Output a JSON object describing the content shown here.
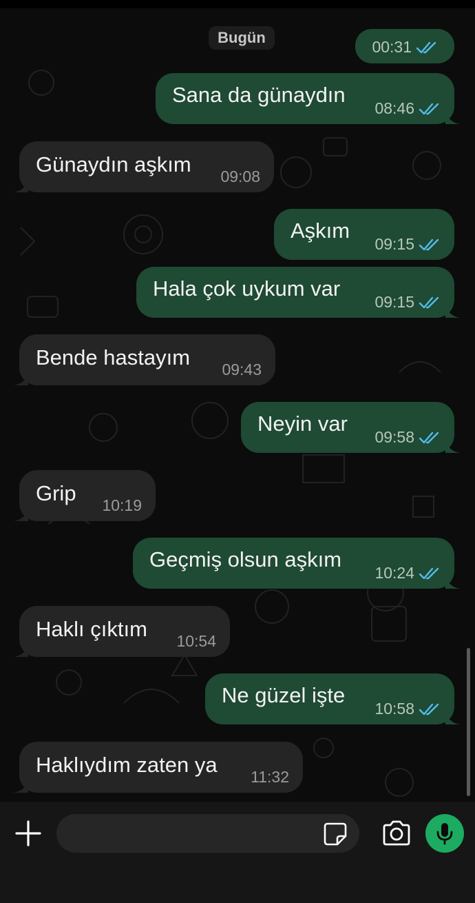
{
  "colors": {
    "outgoing_bubble": "#1f4a34",
    "incoming_bubble": "#252525",
    "read_ticks": "#53bdeb",
    "mic_button": "#1daa61",
    "background": "#0c0c0c"
  },
  "chat": {
    "date_separator": "Bugün",
    "messages": [
      {
        "direction": "out",
        "text": "",
        "time": "00:31",
        "status": "read"
      },
      {
        "direction": "out",
        "text": "Sana da günaydın",
        "time": "08:46",
        "status": "read"
      },
      {
        "direction": "in",
        "text": "Günaydın aşkım",
        "time": "09:08"
      },
      {
        "direction": "out",
        "text": "Aşkım",
        "time": "09:15",
        "status": "read"
      },
      {
        "direction": "out",
        "text": "Hala çok uykum var",
        "time": "09:15",
        "status": "read"
      },
      {
        "direction": "in",
        "text": "Bende hastayım",
        "time": "09:43"
      },
      {
        "direction": "out",
        "text": "Neyin var",
        "time": "09:58",
        "status": "read"
      },
      {
        "direction": "in",
        "text": "Grip",
        "time": "10:19"
      },
      {
        "direction": "out",
        "text": "Geçmiş olsun aşkım",
        "time": "10:24",
        "status": "read"
      },
      {
        "direction": "in",
        "text": "Haklı çıktım",
        "time": "10:54"
      },
      {
        "direction": "out",
        "text": "Ne güzel işte",
        "time": "10:58",
        "status": "read"
      },
      {
        "direction": "in",
        "text": "Haklıydım zaten ya",
        "time": "11:32"
      }
    ]
  },
  "composer": {
    "input_value": "",
    "icons": {
      "attach": "plus-icon",
      "sticker": "sticker-icon",
      "camera": "camera-icon",
      "voice": "microphone-icon"
    }
  }
}
